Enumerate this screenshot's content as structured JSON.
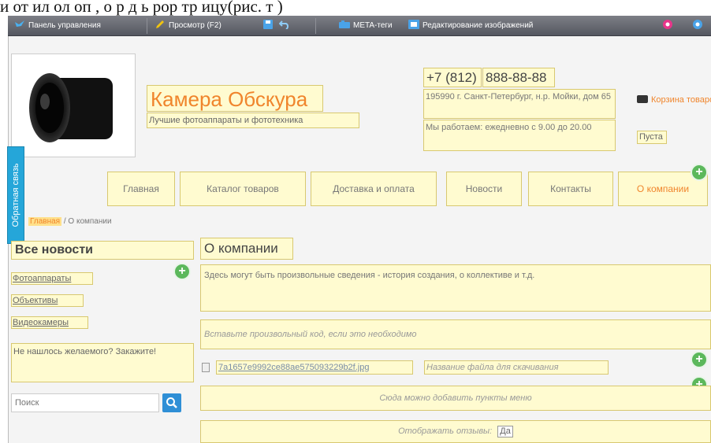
{
  "caption": "и  от  ил  ол  оп ,  о  р д  ь  рор   тр  ицу(рис.  т  )",
  "toolbar": {
    "dashboard": "Панель управления",
    "preview": "Просмотр (F2)",
    "meta": "META-теги",
    "image_edit": "Редактирование изображений"
  },
  "header": {
    "site_title": "Камера Обскура",
    "tagline": "Лучшие фотоаппараты и фототехника",
    "phone_code": "+7 (812)",
    "phone_number": "888-88-88",
    "address": "195990 г. Санкт-Петербург, н.р. Мойки, дом 65",
    "hours": "Мы работаем: ежедневно с 9.00 до 20.00",
    "cart_label": "Корзина товаров",
    "cart_status": "Пуста"
  },
  "feedback_tab": "Обратная связь",
  "nav": [
    {
      "label": "Главная"
    },
    {
      "label": "Каталог товаров"
    },
    {
      "label": "Доставка и оплата"
    },
    {
      "label": "Новости"
    },
    {
      "label": "Контакты"
    },
    {
      "label": "О компании"
    }
  ],
  "breadcrumb": {
    "home": "Главная",
    "current": "/ О компании"
  },
  "sidebar": {
    "news_title": "Все новости",
    "links": [
      "Фотоаппараты",
      "Объективы",
      "Видеокамеры"
    ],
    "order_text": "Не нашлось желаемого? Закажите!",
    "search_placeholder": "Поиск"
  },
  "main": {
    "title": "О компании",
    "text": "Здесь могут быть произвольные сведения - история создания,  о коллективе и т.д.",
    "code_placeholder": "Вставьте произвольный код, если это необходимо",
    "file_link": "7a1657e9992ce88ae575093229b2f.jpg",
    "file_name_placeholder": "Название файла для скачивания",
    "menu_placeholder": "Сюда можно добавить пункты меню",
    "reviews_label": "Отображать отзывы:",
    "reviews_value": "Да"
  },
  "colors": {
    "accent": "#f0852c",
    "editable_bg": "#fffbd0",
    "feedback": "#25a6d9",
    "add_button": "#5cb85c"
  }
}
